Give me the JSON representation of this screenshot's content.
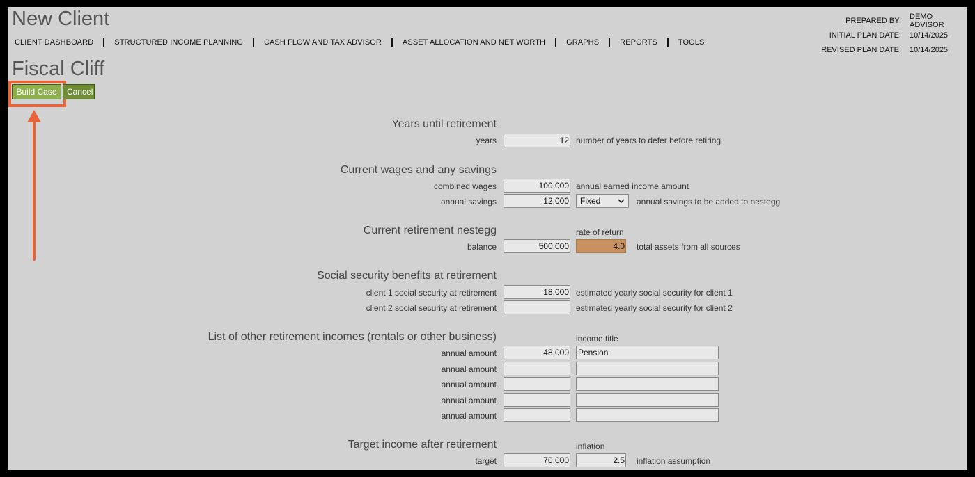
{
  "app": {
    "title": "New Client"
  },
  "nav": [
    "CLIENT DASHBOARD",
    "STRUCTURED INCOME PLANNING",
    "CASH FLOW AND TAX ADVISOR",
    "ASSET ALLOCATION AND NET WORTH",
    "GRAPHS",
    "REPORTS",
    "TOOLS"
  ],
  "meta": {
    "prepared_by_label": "PREPARED BY:",
    "prepared_by": "DEMO ADVISOR",
    "initial_label": "INITIAL PLAN DATE:",
    "initial": "10/14/2025",
    "revised_label": "REVISED PLAN DATE:",
    "revised": "10/14/2025"
  },
  "page": {
    "title": "Fiscal Cliff",
    "build_label": "Build Case",
    "cancel_label": "Cancel"
  },
  "form": {
    "years": {
      "heading": "Years until retirement",
      "label": "years",
      "value": "12",
      "help": "number of years to defer before retiring"
    },
    "wages": {
      "heading": "Current wages and any savings",
      "combined_label": "combined wages",
      "combined_value": "100,000",
      "combined_help": "annual earned income amount",
      "savings_label": "annual savings",
      "savings_value": "12,000",
      "savings_select": "Fixed",
      "savings_help": "annual savings to be added to nestegg"
    },
    "nestegg": {
      "heading": "Current retirement nestegg",
      "rate_label": "rate of return",
      "balance_label": "balance",
      "balance_value": "500,000",
      "rate_value": "4.0",
      "help": "total assets from all sources"
    },
    "social": {
      "heading": "Social security benefits at retirement",
      "c1_label": "client 1 social security at retirement",
      "c1_value": "18,000",
      "c1_help": "estimated yearly social security for client 1",
      "c2_label": "client 2 social security at retirement",
      "c2_value": "",
      "c2_help": "estimated yearly social security for client 2"
    },
    "other": {
      "heading": "List of other retirement incomes (rentals or other business)",
      "title_header": "income title",
      "rows": [
        {
          "label": "annual amount",
          "amount": "48,000",
          "title": "Pension"
        },
        {
          "label": "annual amount",
          "amount": "",
          "title": ""
        },
        {
          "label": "annual amount",
          "amount": "",
          "title": ""
        },
        {
          "label": "annual amount",
          "amount": "",
          "title": ""
        },
        {
          "label": "annual amount",
          "amount": "",
          "title": ""
        }
      ]
    },
    "target": {
      "heading": "Target income after retirement",
      "inflation_label": "inflation",
      "label": "target",
      "value": "70,000",
      "inflation_value": "2.5",
      "help": "inflation assumption"
    }
  },
  "colors": {
    "highlight": "#e7643a",
    "rate_field": "#c8915f",
    "build_button": "#8fae4c"
  }
}
